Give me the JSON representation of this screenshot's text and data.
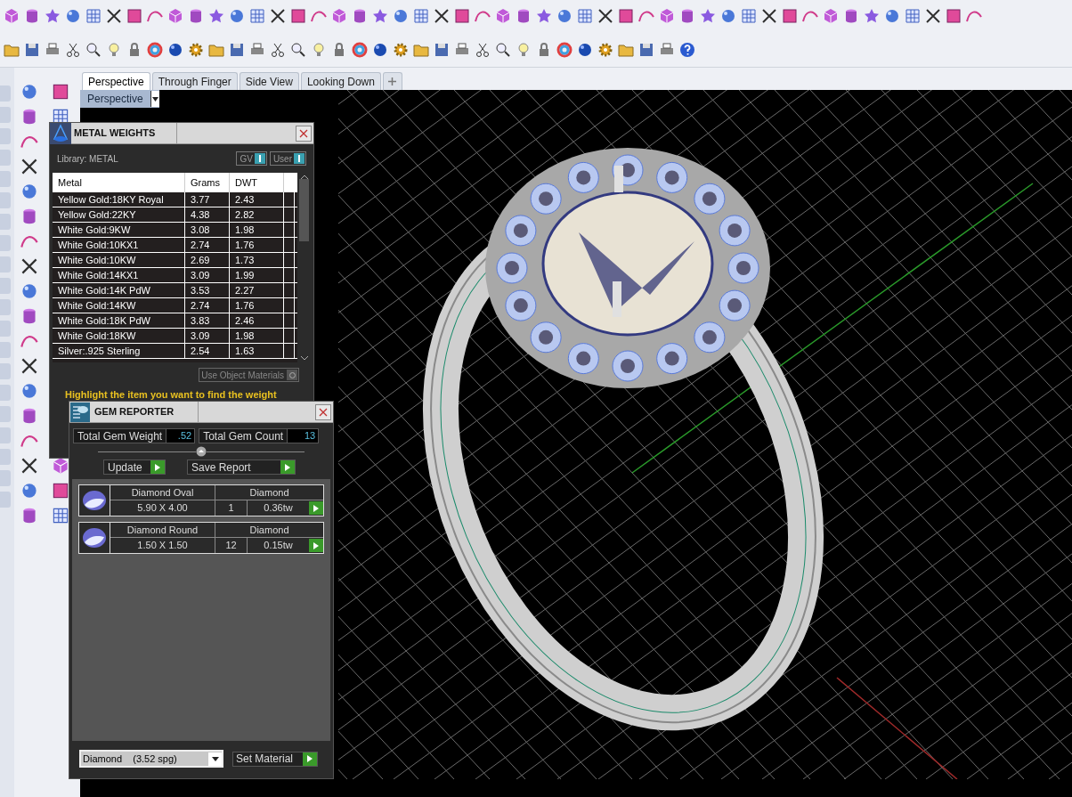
{
  "viewport_tabs": [
    {
      "label": "Perspective",
      "selected": true
    },
    {
      "label": "Through Finger",
      "selected": false
    },
    {
      "label": "Side View",
      "selected": false
    },
    {
      "label": "Looking Down",
      "selected": false
    }
  ],
  "viewport": {
    "label": "Perspective"
  },
  "metal_weights": {
    "title": "METAL WEIGHTS",
    "library": "Library: METAL",
    "toggles": [
      {
        "label": "GV",
        "on": true
      },
      {
        "label": "User",
        "on": true
      }
    ],
    "columns": [
      "Metal",
      "Grams",
      "DWT"
    ],
    "rows": [
      [
        "Yellow Gold:18KY Royal",
        "3.77",
        "2.43"
      ],
      [
        "Yellow Gold:22KY",
        "4.38",
        "2.82"
      ],
      [
        "White Gold:9KW",
        "3.08",
        "1.98"
      ],
      [
        "White Gold:10KX1",
        "2.74",
        "1.76"
      ],
      [
        "White Gold:10KW",
        "2.69",
        "1.73"
      ],
      [
        "White Gold:14KX1",
        "3.09",
        "1.99"
      ],
      [
        "White Gold:14K PdW",
        "3.53",
        "2.27"
      ],
      [
        "White Gold:14KW",
        "2.74",
        "1.76"
      ],
      [
        "White Gold:18K PdW",
        "3.83",
        "2.46"
      ],
      [
        "White Gold:18KW",
        "3.09",
        "1.98"
      ],
      [
        "Silver:.925 Sterling",
        "2.54",
        "1.63"
      ]
    ],
    "use_object_materials": {
      "label": "Use Object Materials",
      "checked": false
    },
    "hint": "Highlight the item you want to find the weight"
  },
  "gem_reporter": {
    "title": "GEM REPORTER",
    "total_weight": {
      "label": "Total Gem Weight",
      "value": ".52"
    },
    "total_count": {
      "label": "Total Gem Count",
      "value": "13"
    },
    "buttons": [
      "Update",
      "Save Report"
    ],
    "gems": [
      {
        "name": "Diamond Oval",
        "material": "Diamond",
        "size": "5.90 X 4.00",
        "count": "1",
        "weight": "0.36tw"
      },
      {
        "name": "Diamond Round",
        "material": "Diamond",
        "size": "1.50 X 1.50",
        "count": "12",
        "weight": "0.15tw"
      }
    ],
    "material_select": "Diamond    (3.52 spg)",
    "set_material": "Set Material"
  }
}
